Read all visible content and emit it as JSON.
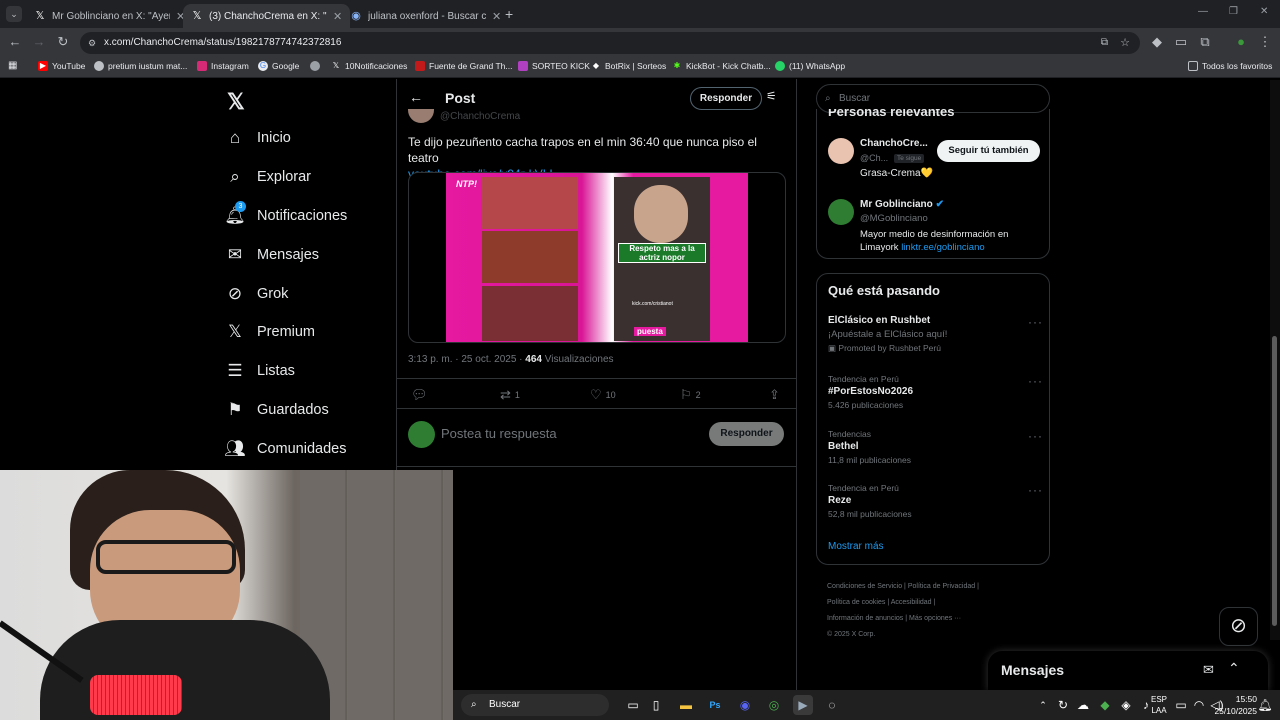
{
  "browser": {
    "tabs": [
      {
        "title": "Mr Goblinciano en X: \"Ayer la se",
        "icon": "x-logo-icon"
      },
      {
        "title": "(3) ChanchoCrema en X: \"@MG",
        "icon": "x-logo-icon"
      },
      {
        "title": "juliana oxenford - Buscar con G",
        "icon": "google-icon"
      }
    ],
    "url": "x.com/ChanchoCrema/status/1982178774742372816",
    "bookmarks": [
      "YouTube",
      "pretium iustum mat...",
      "Instagram",
      "Google",
      "10Notificaciones",
      "Fuente de Grand Th...",
      "SORTEO KICK",
      "BotRix | Sorteos",
      "KickBot - Kick Chatb...",
      "(11) WhatsApp"
    ],
    "all_bookmarks": "Todos los favoritos"
  },
  "nav": {
    "items": [
      {
        "label": "Inicio",
        "icon": "home-icon"
      },
      {
        "label": "Explorar",
        "icon": "search-icon"
      },
      {
        "label": "Notificaciones",
        "icon": "bell-icon",
        "badge": "3"
      },
      {
        "label": "Mensajes",
        "icon": "mail-icon"
      },
      {
        "label": "Grok",
        "icon": "grok-icon"
      },
      {
        "label": "Premium",
        "icon": "x-logo-icon"
      },
      {
        "label": "Listas",
        "icon": "list-icon"
      },
      {
        "label": "Guardados",
        "icon": "bookmark-icon"
      },
      {
        "label": "Comunidades",
        "icon": "people-icon"
      }
    ]
  },
  "post": {
    "header": "Post",
    "reply_button": "Responder",
    "handle": "@ChanchoCrema",
    "text": "Te dijo pezuñento cacha trapos en el min 36:40 que nunca piso el teatro",
    "link": "youtube.com/live/y94r-kVLI...",
    "media_caption": "Respeto mas a la actriz nopor",
    "media_badge": "NTP!",
    "media_small_text": "kick.com/cristianot",
    "media_bottom": "puesta",
    "time": "3:13 p. m. · 25 oct. 2025 · ",
    "views_count": "464",
    "views_label": " Visualizaciones",
    "stats": {
      "retweets": "1",
      "likes": "10",
      "bookmarks": "2"
    },
    "reply_placeholder": "Postea tu respuesta",
    "reply_submit": "Responder"
  },
  "sidebar": {
    "search_placeholder": "Buscar",
    "relevant_title": "Personas relevantes",
    "people": [
      {
        "name": "ChanchoCre...",
        "handle": "@Ch...",
        "follows_you": "Te sigue",
        "bio": "Grasa-Crema💛",
        "button": "Seguir tú también"
      },
      {
        "name": "Mr Goblinciano",
        "handle": "@MGoblinciano",
        "bio": "Mayor medio de desinformación en Limayork ",
        "bio_link": "linktr.ee/goblinciano"
      }
    ],
    "trends_title": "Qué está pasando",
    "trends": [
      {
        "top": "",
        "name": "ElClásico en Rushbet",
        "sub": "¡Apuéstale a ElClásico aquí!",
        "promo": "Promoted by Rushbet Perú"
      },
      {
        "top": "Tendencia en Perú",
        "name": "#PorEstosNo2026",
        "sub": "5.426 publicaciones"
      },
      {
        "top": "Tendencias",
        "name": "Bethel",
        "sub": "11,8 mil publicaciones"
      },
      {
        "top": "Tendencia en Perú",
        "name": "Reze",
        "sub": "52,8 mil publicaciones"
      }
    ],
    "show_more": "Mostrar más",
    "footer": [
      "Condiciones de Servicio",
      "Política de Privacidad",
      "Política de cookies",
      "Accesibilidad",
      "Información de anuncios",
      "Más opciones ···",
      "© 2025 X Corp."
    ]
  },
  "messages_drawer": {
    "title": "Mensajes"
  },
  "taskbar": {
    "search": "Buscar",
    "lang1": "ESP",
    "lang2": "LAA",
    "time": "15:50",
    "date": "25/10/2025"
  },
  "colors": {
    "accent": "#1d9bf0",
    "media_pink": "#e619a1",
    "bg": "#000000"
  }
}
